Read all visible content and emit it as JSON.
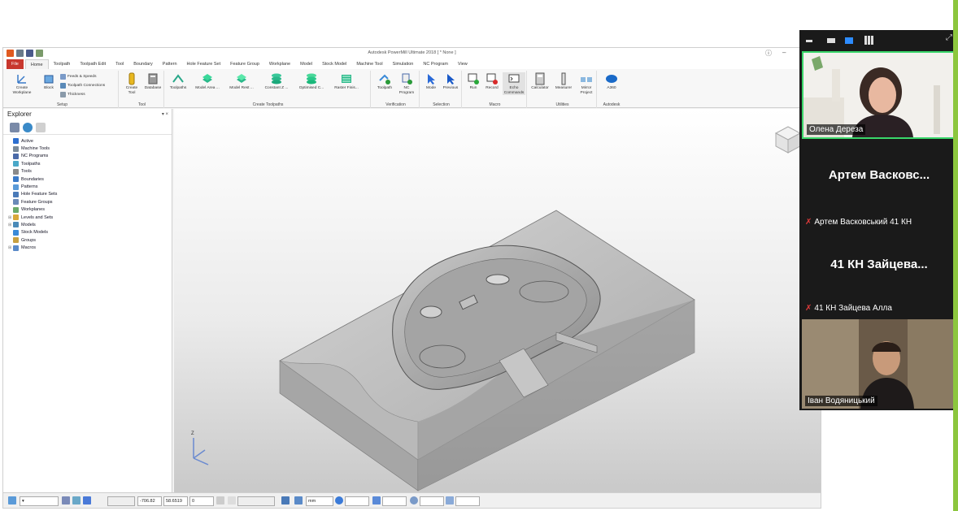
{
  "app": {
    "title": "Autodesk PowerMill Ultimate 2018   [ * None ]",
    "ribbon_tabs": [
      "File",
      "Home",
      "Toolpath",
      "Toolpath Edit",
      "Tool",
      "Boundary",
      "Pattern",
      "Hole Feature Set",
      "Feature Group",
      "Workplane",
      "Model",
      "Stock Model",
      "Machine Tool",
      "Simulation",
      "NC Program",
      "View"
    ],
    "active_tab": "Home",
    "groups": {
      "setup": {
        "label": "Setup",
        "create_workplane": "Create Workplane",
        "block": "Block",
        "feeds_speeds": "Feeds & Speeds",
        "toolpath_connections": "Toolpath Connections",
        "thickness": "Thickness"
      },
      "tool": {
        "label": "Tool",
        "create_tool": "Create Tool",
        "database": "Database"
      },
      "create_toolpaths": {
        "label": "Create Toolpaths",
        "items": [
          "Toolpaths",
          "Model Area ...",
          "Model Rest ...",
          "Constant Z ...",
          "Optimised C...",
          "Raster Finis..."
        ]
      },
      "verification": {
        "label": "Verification",
        "toolpath": "Toolpath",
        "nc_program": "NC Program"
      },
      "selection": {
        "label": "Selection",
        "mode": "Mode",
        "previous": "Previous"
      },
      "macro": {
        "label": "Macro",
        "run": "Run",
        "record": "Record",
        "echo": "Echo Commands"
      },
      "utilities": {
        "label": "Utilities",
        "calculator": "Calculator",
        "measurer": "Measurer",
        "mirror": "Mirror Project"
      },
      "autodesk": {
        "label": "Autodesk",
        "a360": "A360"
      }
    }
  },
  "explorer": {
    "title": "Explorer",
    "items": [
      {
        "label": "Active",
        "expandable": false,
        "color": "#2d6fd0"
      },
      {
        "label": "Machine Tools",
        "expandable": false,
        "color": "#7a8a9a"
      },
      {
        "label": "NC Programs",
        "expandable": false,
        "color": "#4a6aa8"
      },
      {
        "label": "Toolpaths",
        "expandable": false,
        "color": "#4aa8c8"
      },
      {
        "label": "Tools",
        "expandable": false,
        "color": "#8a8a8a"
      },
      {
        "label": "Boundaries",
        "expandable": false,
        "color": "#3a7ac8"
      },
      {
        "label": "Patterns",
        "expandable": false,
        "color": "#5a9ad8"
      },
      {
        "label": "Hole Feature Sets",
        "expandable": false,
        "color": "#4a7ab8"
      },
      {
        "label": "Feature Groups",
        "expandable": false,
        "color": "#6a8ab8"
      },
      {
        "label": "Workplanes",
        "expandable": false,
        "color": "#6aaa6a"
      },
      {
        "label": "Levels and Sets",
        "expandable": true,
        "color": "#d8a83a"
      },
      {
        "label": "Models",
        "expandable": true,
        "color": "#4a8ab8"
      },
      {
        "label": "Stock Models",
        "expandable": false,
        "color": "#3a8ad8"
      },
      {
        "label": "Groups",
        "expandable": false,
        "color": "#c8a040"
      },
      {
        "label": "Macros",
        "expandable": true,
        "color": "#5a8ac8"
      }
    ]
  },
  "status": {
    "x": "-706.82",
    "y": "58.6519",
    "z": "0",
    "units": "mm"
  },
  "zoom": {
    "participants": [
      {
        "name": "Олена Дереза",
        "video": true
      },
      {
        "name": "Артем Васковс...",
        "full_name": "Артем Васковський 41 КН",
        "video": false
      },
      {
        "name": "41 КН Зайцева...",
        "full_name": "41 КН Зайцева Алла",
        "video": false
      },
      {
        "name": "Іван Водяницький",
        "video": true
      }
    ]
  }
}
